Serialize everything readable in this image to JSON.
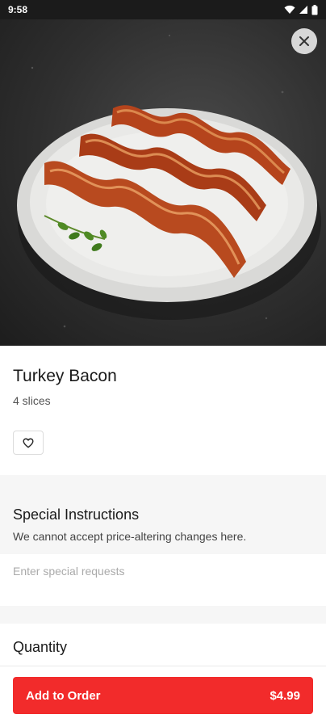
{
  "status_bar": {
    "time": "9:58",
    "icons": [
      "wifi-icon",
      "signal-icon",
      "battery-icon"
    ]
  },
  "hero": {
    "image": "turkey-bacon-on-plate",
    "close_icon": "close-icon"
  },
  "item": {
    "name": "Turkey Bacon",
    "description": "4 slices",
    "favorite_icon": "heart-outline-icon"
  },
  "special_instructions": {
    "title": "Special Instructions",
    "note": "We cannot accept price-altering changes here.",
    "placeholder": "Enter special requests",
    "value": ""
  },
  "quantity": {
    "title": "Quantity"
  },
  "order_button": {
    "label": "Add to Order",
    "price": "$4.99"
  },
  "colors": {
    "accent": "#f22b2b",
    "status_bar": "#1b1b1b",
    "section_band": "#f6f6f6"
  }
}
